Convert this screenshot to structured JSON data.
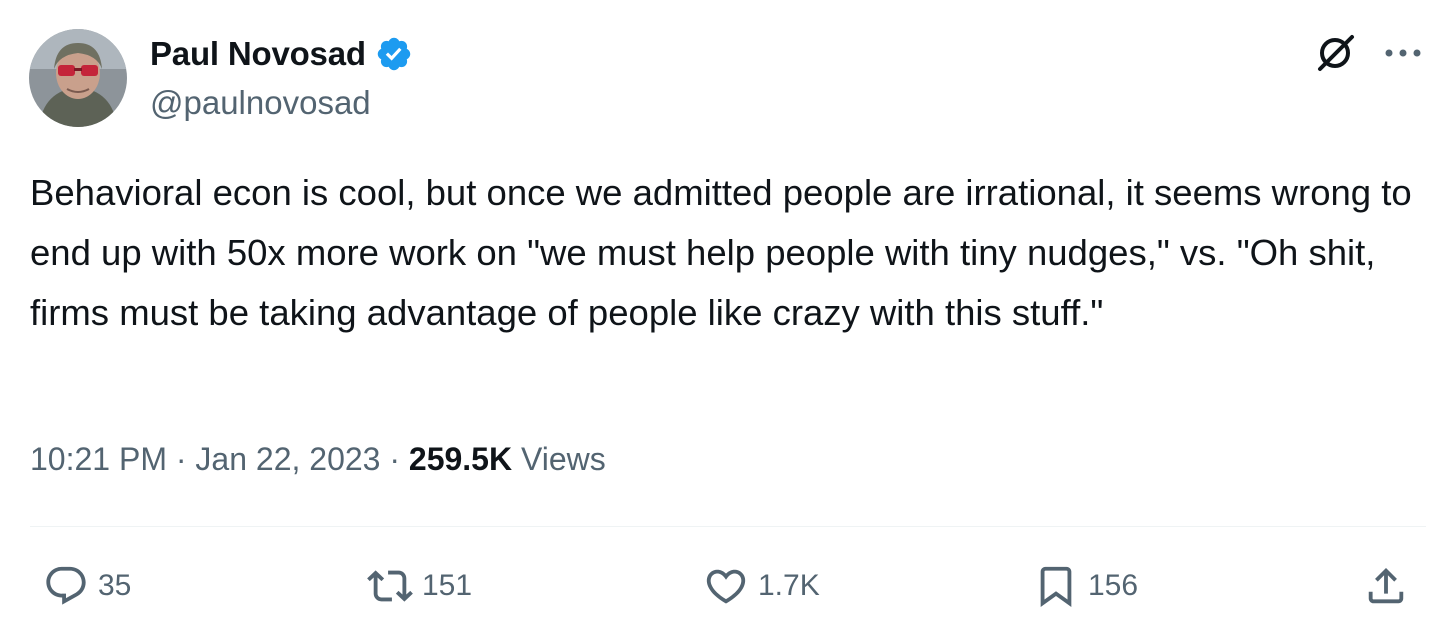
{
  "author": {
    "display_name": "Paul Novosad",
    "handle": "@paulnovosad",
    "verified": true,
    "verified_color": "#1d9bf0"
  },
  "tweet": {
    "text": "Behavioral econ is cool, but once we admitted people are irrational, it seems wrong to end up with 50x more work on \"we must help people with tiny nudges,\" vs. \"Oh shit, firms must be taking advantage of people like crazy with this stuff.\"",
    "time": "10:21 PM",
    "separator": " · ",
    "date": "Jan 22, 2023",
    "views_count": "259.5K",
    "views_label": "Views"
  },
  "actions": {
    "replies": "35",
    "retweets": "151",
    "likes": "1.7K",
    "bookmarks": "156"
  },
  "icons": {
    "grok": "grok-icon",
    "more": "more-icon",
    "reply": "reply-icon",
    "retweet": "retweet-icon",
    "like": "heart-icon",
    "bookmark": "bookmark-icon",
    "share": "share-icon"
  },
  "colors": {
    "text_primary": "#0f1419",
    "text_secondary": "#536471",
    "divider": "#eff3f4"
  }
}
